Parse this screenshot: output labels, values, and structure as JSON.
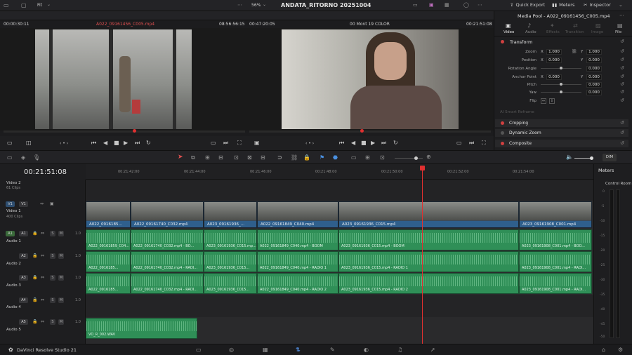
{
  "app": {
    "project_title": "ANDATA_RITORNO 20251004",
    "status": "Edited",
    "product": "DaVinci Resolve Studio 21"
  },
  "topbar": {
    "fit_label": "Fit",
    "zoom_label": "56%",
    "quick_export": "Quick Export",
    "meters": "Meters",
    "inspector": "Inspector"
  },
  "source_viewer": {
    "timecode_left": "00:00:30:11",
    "clip_name": "A022_09161456_C005.mp4",
    "timecode_right": "08:56:56:15"
  },
  "timeline_viewer": {
    "timecode_left": "00:47:20:05",
    "clip_name": "00 Mont 19 COLOR",
    "timecode_right": "00:21:51:08"
  },
  "inspector": {
    "header": "Media Pool - A022_09161456_C005.mp4",
    "tabs": [
      "Video",
      "Audio",
      "Effects",
      "Transition",
      "Image",
      "File"
    ],
    "transform_title": "Transform",
    "zoom": {
      "label": "Zoom",
      "x": "1.000",
      "y": "1.000"
    },
    "position": {
      "label": "Position",
      "x": "0.000",
      "y": "0.000"
    },
    "rotation": {
      "label": "Rotation Angle",
      "v": "0.000"
    },
    "anchor": {
      "label": "Anchor Point",
      "x": "0.000",
      "y": "0.000"
    },
    "pitch": {
      "label": "Pitch",
      "v": "0.000"
    },
    "yaw": {
      "label": "Yaw",
      "v": "0.000"
    },
    "flip": {
      "label": "Flip"
    },
    "ai_smart": "AI Smart Reframe",
    "cropping": "Cropping",
    "dynamic_zoom": "Dynamic Zoom",
    "composite": "Composite",
    "axis_x": "X",
    "axis_y": "Y"
  },
  "timeline": {
    "timecode": "00:21:51:08",
    "ruler": [
      "00:21:42:00",
      "00:21:44:00",
      "00:21:46:00",
      "00:21:48:00",
      "00:21:50:00",
      "00:21:52:00",
      "00:21:54:00"
    ],
    "dim": "DIM",
    "tracks": [
      {
        "badge": "V2",
        "name": "Video 2",
        "count": "61 Clips"
      },
      {
        "badge": "V1",
        "name": "Video 1",
        "count": "400 Clips"
      },
      {
        "badge": "A1",
        "name": "Audio 1",
        "level": "1.0"
      },
      {
        "badge": "A2",
        "name": "Audio 2",
        "level": "1.0"
      },
      {
        "badge": "A3",
        "name": "Audio 3",
        "level": "1.0"
      },
      {
        "badge": "A4",
        "name": "Audio 4",
        "level": "1.0"
      },
      {
        "badge": "A5",
        "name": "Audio 5",
        "level": "1.0"
      }
    ],
    "video_clips": [
      "A022_0916185...",
      "A022_09161740_C032.mp4",
      "A023_09161936_...",
      "A022_09161849_C040.mp4",
      "A023_09161936_C015.mp4",
      "A023_09161908_C001.mp4"
    ],
    "audio1": [
      "A022_09161859_C04...",
      "A022_09161740_C032.mp4 - BO...",
      "A023_09161936_C015.mp...",
      "A022_09161849_C040.mp4 - BOOM",
      "A023_09161936_C015.mp4 - BOOM",
      "A023_09161908_C001.mp4 - BOO..."
    ],
    "audio2": [
      "A022_0916185...",
      "A022_09161740_C032.mp4 - RADI...",
      "A023_09161936_C015...",
      "A022_09161849_C040.mp4 - RADIO 1",
      "A023_09161936_C015.mp4 - RADIO 1",
      "A023_09161908_C001.mp4 - RADI..."
    ],
    "audio3": [
      "A022_0916185...",
      "A022_09161740_C032.mp4 - RADI...",
      "A023_09161936_C015...",
      "A022_09161849_C040.mp4 - RADIO 2",
      "A023_09161936_C015.mp4 - RADIO 2",
      "A023_09161908_C001.mp4 - RADI..."
    ],
    "audio5": [
      "VO_R_002.WAV"
    ]
  },
  "meters": {
    "title": "Meters",
    "control_room": "Control Room",
    "scale": [
      "0",
      "-5",
      "-10",
      "-15",
      "-20",
      "-25",
      "-30",
      "-35",
      "-40",
      "-45",
      "-50"
    ]
  },
  "colors": {
    "accent": "#e03030",
    "video_clip": "#2f5f8c",
    "audio_clip": "#2f8f57"
  }
}
